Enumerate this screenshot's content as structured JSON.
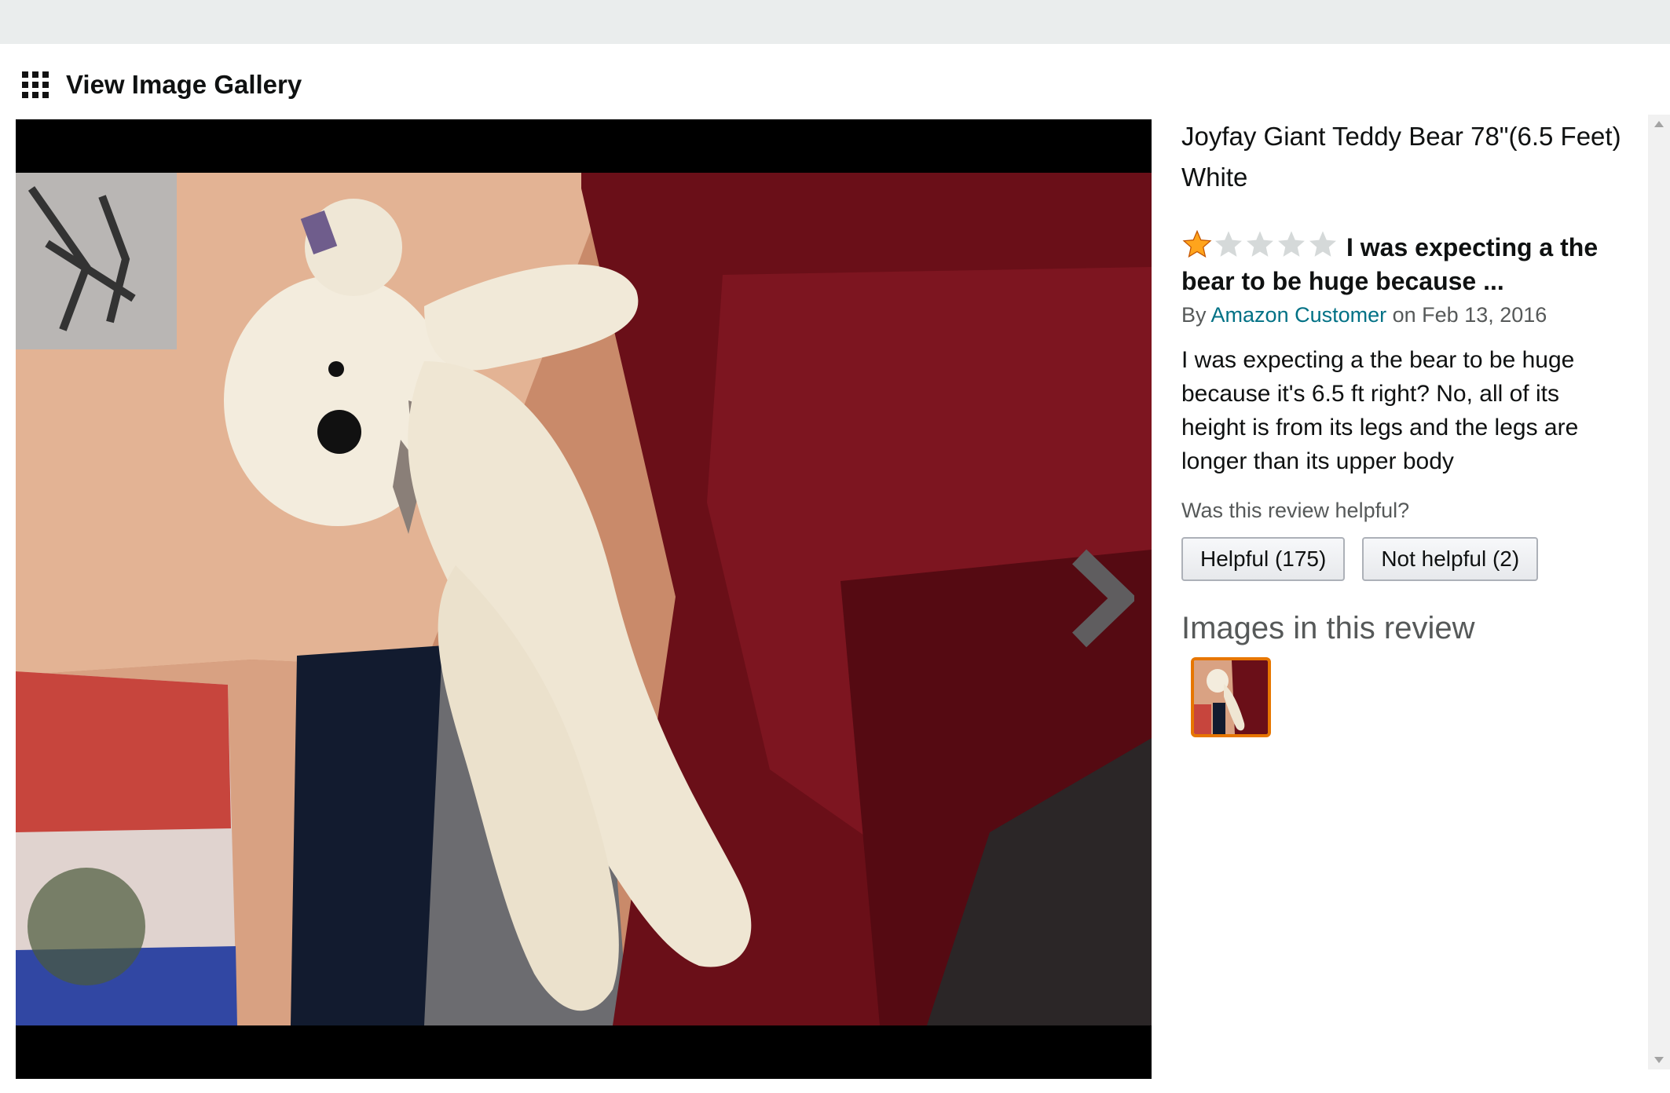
{
  "gallery": {
    "label": "View Image Gallery"
  },
  "product": {
    "title": "Joyfay Giant Teddy Bear 78\"(6.5 Feet) White"
  },
  "review": {
    "rating": 1,
    "rating_max": 5,
    "headline": "I was expecting a the bear to be huge because ...",
    "by_prefix": "By",
    "author": "Amazon Customer",
    "date_text": "on Feb 13, 2016",
    "body": "I was expecting a the bear to be huge because it's 6.5 ft right? No, all of its height is from its legs and the legs are longer than its upper body",
    "helpful_question": "Was this review helpful?",
    "helpful_label": "Helpful (175)",
    "not_helpful_label": "Not helpful (2)",
    "images_title": "Images in this review"
  },
  "colors": {
    "star_filled": "#ffa41c",
    "star_empty": "#d5d9d9",
    "link": "#007185",
    "thumb_border": "#e77600"
  }
}
